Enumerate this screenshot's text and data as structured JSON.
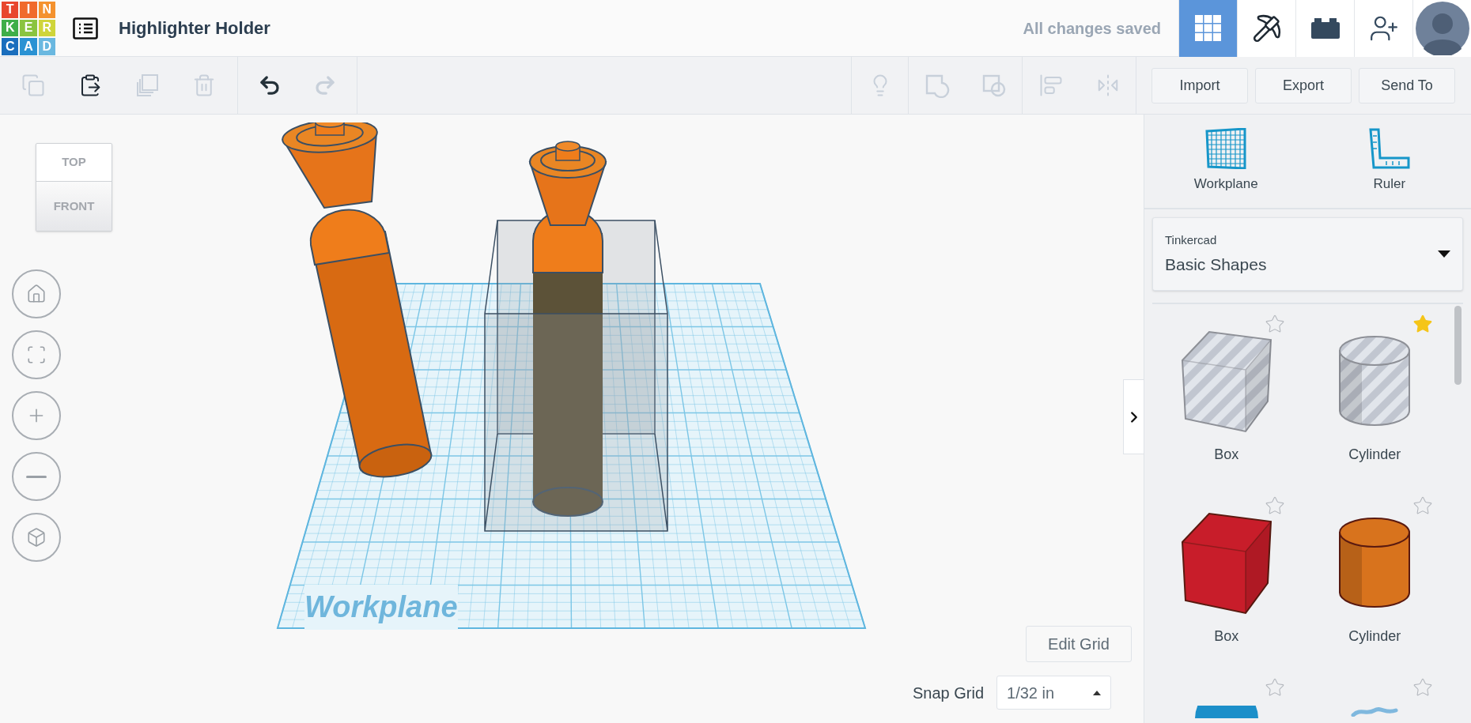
{
  "logo_letters": [
    {
      "char": "T",
      "color": "#e8462e"
    },
    {
      "char": "I",
      "color": "#f06a2c"
    },
    {
      "char": "N",
      "color": "#f4922e"
    },
    {
      "char": "K",
      "color": "#3fae49"
    },
    {
      "char": "E",
      "color": "#8ac440"
    },
    {
      "char": "R",
      "color": "#cfd53b"
    },
    {
      "char": "C",
      "color": "#1a6ebd"
    },
    {
      "char": "A",
      "color": "#2a92d3"
    },
    {
      "char": "D",
      "color": "#6ab8e0"
    }
  ],
  "project_title": "Highlighter Holder",
  "save_status": "All changes saved",
  "nav_buttons": [
    {
      "kind": "grid",
      "selected": true
    },
    {
      "kind": "pickaxe",
      "selected": false
    },
    {
      "kind": "bricks",
      "selected": false
    },
    {
      "kind": "invite",
      "selected": false
    }
  ],
  "edit_tools": [
    {
      "kind": "copy",
      "disabled": true
    },
    {
      "kind": "paste",
      "disabled": false
    },
    {
      "kind": "duplicate",
      "disabled": true
    },
    {
      "kind": "delete",
      "disabled": true
    }
  ],
  "history_tools": [
    {
      "kind": "undo",
      "disabled": false
    },
    {
      "kind": "redo",
      "disabled": true
    }
  ],
  "shape_tools": [
    {
      "kind": "notes",
      "disabled": true
    },
    {
      "kind": "group",
      "disabled": true
    },
    {
      "kind": "ungroup",
      "disabled": true
    },
    {
      "kind": "align",
      "disabled": true
    },
    {
      "kind": "mirror",
      "disabled": true
    }
  ],
  "action_buttons": [
    "Import",
    "Export",
    "Send To"
  ],
  "view_cube": {
    "top": "TOP",
    "front": "FRONT"
  },
  "view_controls": [
    {
      "kind": "home"
    },
    {
      "kind": "fit"
    },
    {
      "kind": "zoom_in"
    },
    {
      "kind": "zoom_out"
    },
    {
      "kind": "perspective"
    }
  ],
  "workplane_label": "Workplane",
  "edit_grid": "Edit Grid",
  "snap_grid": {
    "label": "Snap Grid",
    "value": "1/32 in"
  },
  "panel_tools": [
    {
      "kind": "workplane",
      "label": "Workplane"
    },
    {
      "kind": "ruler",
      "label": "Ruler"
    }
  ],
  "library": {
    "source": "Tinkercad",
    "selected": "Basic Shapes"
  },
  "shapes": [
    {
      "kind": "box",
      "hole": true,
      "color": "#b9bfca",
      "label": "Box",
      "favorite": false
    },
    {
      "kind": "cylinder",
      "hole": true,
      "color": "#b9bfca",
      "label": "Cylinder",
      "favorite": true
    },
    {
      "kind": "box",
      "hole": false,
      "color": "#c81d2a",
      "label": "Box",
      "favorite": false
    },
    {
      "kind": "cylinder",
      "hole": false,
      "color": "#d8731d",
      "label": "Cylinder",
      "favorite": false
    },
    {
      "kind": "sphere",
      "color": "#1c8fc9",
      "favorite": false
    },
    {
      "kind": "scribble",
      "color": "#7fb8de",
      "favorite": false
    }
  ]
}
